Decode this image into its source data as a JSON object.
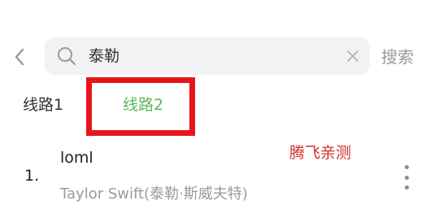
{
  "header": {
    "search_query": "泰勒",
    "search_button": "搜索"
  },
  "tabs": [
    {
      "label": "线路1",
      "selected": false
    },
    {
      "label": "线路2",
      "selected": true
    }
  ],
  "watermark": "腾飞亲测",
  "results": [
    {
      "index": "1.",
      "title": "loml",
      "artist": "Taylor Swift(泰勒·斯威夫特)"
    }
  ],
  "icons": {
    "back": "back-arrow-icon",
    "search": "search-icon",
    "clear": "clear-icon",
    "more": "more-vertical-icon"
  },
  "colors": {
    "accent": "#5bb75b",
    "highlight": "#e8141c",
    "watermark": "#d32f2f",
    "search_bg": "#f2f2f2",
    "secondary_text": "#9a9a9a"
  }
}
